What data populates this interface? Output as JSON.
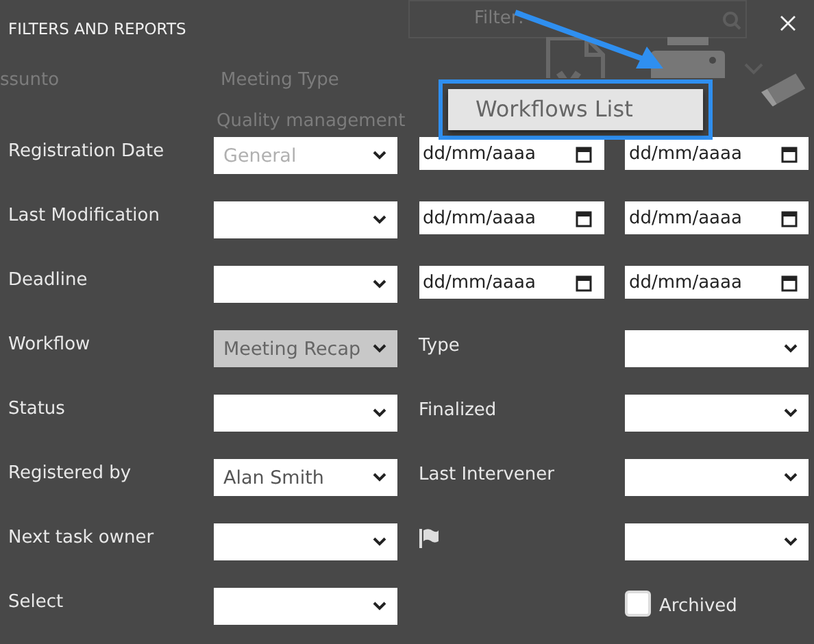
{
  "title": "FILTERS AND REPORTS",
  "background": {
    "search_label": "Filter:",
    "columns": [
      "ssunto",
      "Meeting Type"
    ],
    "cell": "Quality management"
  },
  "menu": {
    "items": [
      {
        "label": "Workflows List",
        "selected": true
      }
    ]
  },
  "rows": [
    {
      "label": "Registration Date",
      "field": {
        "kind": "select",
        "placeholder": "General",
        "disabled": false
      },
      "middle": {
        "kind": "date",
        "placeholder": "dd/mm/aaaa"
      },
      "right": {
        "kind": "date",
        "placeholder": "dd/mm/aaaa"
      }
    },
    {
      "label": "Last Modification",
      "field": {
        "kind": "select",
        "disabled": false
      },
      "middle": {
        "kind": "date",
        "placeholder": "dd/mm/aaaa"
      },
      "right": {
        "kind": "date",
        "placeholder": "dd/mm/aaaa"
      }
    },
    {
      "label": "Deadline",
      "field": {
        "kind": "select",
        "disabled": false
      },
      "middle": {
        "kind": "date",
        "placeholder": "dd/mm/aaaa"
      },
      "right": {
        "kind": "date",
        "placeholder": "dd/mm/aaaa"
      }
    },
    {
      "label": "Workflow",
      "field": {
        "kind": "select",
        "value": "Meeting Recap",
        "disabled": true
      },
      "middle": {
        "kind": "label",
        "text": "Type"
      },
      "right": {
        "kind": "select",
        "disabled": false
      }
    },
    {
      "label": "Status",
      "field": {
        "kind": "select",
        "disabled": false
      },
      "middle": {
        "kind": "label",
        "text": "Finalized"
      },
      "right": {
        "kind": "select",
        "disabled": false
      }
    },
    {
      "label": "Registered by",
      "field": {
        "kind": "select",
        "value": "Alan Smith",
        "disabled": false
      },
      "middle": {
        "kind": "label",
        "text": "Last Intervener"
      },
      "right": {
        "kind": "select",
        "disabled": false
      }
    },
    {
      "label": "Next task owner",
      "field": {
        "kind": "select",
        "disabled": false
      },
      "middle": {
        "kind": "flag"
      },
      "right": {
        "kind": "select",
        "disabled": false
      }
    },
    {
      "label": "Select",
      "field": {
        "kind": "select",
        "disabled": false
      },
      "right": {
        "kind": "checkbox",
        "label": "Archived",
        "checked": false
      }
    }
  ]
}
